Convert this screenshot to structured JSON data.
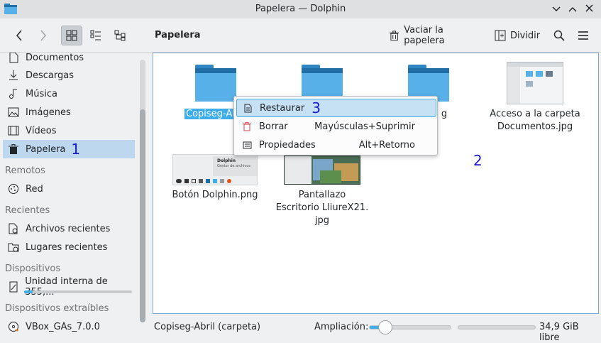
{
  "window": {
    "title": "Papelera — Dolphin"
  },
  "toolbar": {
    "location": "Papelera",
    "empty_trash_label": "Vaciar la papelera",
    "split_label": "Dividir"
  },
  "sidebar": {
    "places": [
      {
        "label": "Documentos",
        "icon": "document-icon"
      },
      {
        "label": "Descargas",
        "icon": "download-icon"
      },
      {
        "label": "Música",
        "icon": "music-icon"
      },
      {
        "label": "Imágenes",
        "icon": "image-icon"
      },
      {
        "label": "Vídeos",
        "icon": "video-icon"
      },
      {
        "label": "Papelera",
        "icon": "trash-icon",
        "selected": true,
        "annotation": "1"
      }
    ],
    "sections": {
      "remote": "Remotos",
      "recent": "Recientes",
      "devices": "Dispositivos",
      "removable": "Dispositivos extraíbles"
    },
    "remote_items": [
      {
        "label": "Red",
        "icon": "network-icon"
      }
    ],
    "recent_items": [
      {
        "label": "Archivos recientes",
        "icon": "recent-files-icon"
      },
      {
        "label": "Lugares recientes",
        "icon": "recent-places-icon"
      }
    ],
    "device_items": [
      {
        "label": "Unidad interna de 355,...",
        "icon": "drive-icon",
        "usage_fraction": 0.08
      }
    ],
    "removable_items": [
      {
        "label": "VBox_GAs_7.0.0",
        "icon": "disc-icon"
      }
    ]
  },
  "files": [
    {
      "name": "Copiseg-Ab",
      "type": "folder",
      "selected": true
    },
    {
      "name": "",
      "type": "folder"
    },
    {
      "name": "g",
      "type": "folder"
    },
    {
      "name": "Acceso a la carpeta Documentos.jpg",
      "line1": "Acceso a la carpeta",
      "line2": "Documentos.jpg",
      "type": "image"
    },
    {
      "name": "Botón Dolphin.png",
      "type": "image",
      "thumb_title": "Dolphin",
      "thumb_subtitle": "Gestor de archivos"
    },
    {
      "name": "Pantallazo Escritorio LliureX21.jpg",
      "line1": "Pantallazo",
      "line2": "Escritorio LliureX21.",
      "line3": "jpg",
      "type": "image"
    }
  ],
  "annotations": {
    "sidebar": "1",
    "view": "2",
    "menu": "3"
  },
  "context_menu": {
    "items": [
      {
        "label": "Restaurar",
        "icon": "restore-icon",
        "shortcut": "",
        "highlighted": true
      },
      {
        "label": "Borrar",
        "icon": "delete-icon",
        "shortcut": "Mayúsculas+Suprimir"
      },
      {
        "label": "Propiedades",
        "icon": "properties-icon",
        "shortcut": "Alt+Retorno"
      }
    ]
  },
  "statusbar": {
    "selection_text": "Copiseg-Abril (carpeta)",
    "zoom_label": "Ampliación:",
    "zoom_fraction": 0.2,
    "free_space": "34,9 GiB libre"
  }
}
